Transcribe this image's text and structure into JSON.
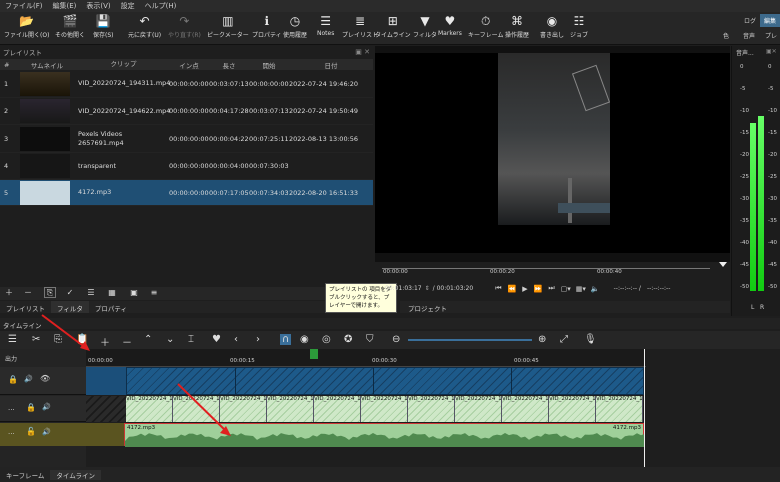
{
  "menu": [
    "ファイル(F)",
    "編集(E)",
    "表示(V)",
    "設定",
    "ヘルプ(H)"
  ],
  "toolbar": [
    {
      "icon": "folder-icon",
      "label": "ファイル開く(O)"
    },
    {
      "icon": "clapper-icon",
      "label": "その他開く"
    },
    {
      "icon": "save-icon",
      "label": "保存(S)"
    },
    {
      "icon": "undo-icon",
      "label": "元に戻す(U)"
    },
    {
      "icon": "redo-icon",
      "label": "やり直す(R)"
    },
    {
      "icon": "peak-meter-icon",
      "label": "ピークメーター"
    },
    {
      "icon": "info-icon",
      "label": "プロパティ"
    },
    {
      "icon": "history-icon",
      "label": "使用履歴"
    },
    {
      "icon": "notes-icon",
      "label": "Notes"
    },
    {
      "icon": "playlist-icon",
      "label": "プレイリスト"
    },
    {
      "icon": "timeline-icon",
      "label": "タイムライン"
    },
    {
      "icon": "filter-icon",
      "label": "フィルタ"
    },
    {
      "icon": "markers-icon",
      "label": "Markers"
    },
    {
      "icon": "keyframe-icon",
      "label": "キーフレーム"
    },
    {
      "icon": "history2-icon",
      "label": "操作履歴"
    },
    {
      "icon": "export-icon",
      "label": "書き出し"
    },
    {
      "icon": "jobs-icon",
      "label": "ジョブ"
    }
  ],
  "workspace": {
    "log": "ログ",
    "edit": "編集",
    "color": "色",
    "audio": "音声",
    "player": "プレ"
  },
  "playlist": {
    "title": "プレイリスト",
    "headers": [
      "#",
      "サムネイル",
      "クリップ",
      "イン点",
      "長さ",
      "開始",
      "日付"
    ],
    "rows": [
      {
        "num": "1",
        "clip": "VID_20220724_194311.mp4",
        "in": "00:00:00:00",
        "len": "00:03:07:13",
        "start": "00:00:00:00",
        "date": "2022-07-24 19:46:20"
      },
      {
        "num": "2",
        "clip": "VID_20220724_194622.mp4",
        "in": "00:00:00:00",
        "len": "00:04:17:28",
        "start": "00:03:07:13",
        "date": "2022-07-24 19:50:49"
      },
      {
        "num": "3",
        "clip": "Pexels Videos 2657691.mp4",
        "in": "00:00:00:00",
        "len": "00:00:04:22",
        "start": "00:07:25:11",
        "date": "2022-08-13 13:00:56"
      },
      {
        "num": "4",
        "clip": "transparent",
        "in": "00:00:00:00",
        "len": "00:00:04:00",
        "start": "00:07:30:03",
        "date": ""
      },
      {
        "num": "5",
        "clip": "4172.mp3",
        "in": "00:00:00:00",
        "len": "00:07:17:05",
        "start": "00:07:34:03",
        "date": "2022-08-20 16:51:33"
      }
    ],
    "tabs": [
      "プレイリスト",
      "フィルタ",
      "プロパティ"
    ]
  },
  "tooltip": "プレイリストの 項目をダブルクリックすると、プレイヤーで開けます。",
  "player": {
    "ruler": [
      "00:00:00",
      "00:00:20",
      "00:00:40"
    ],
    "current": "00:01:03:17",
    "total": "/ 00:01:03:20",
    "in_out": "--:--:--:-- /",
    "in_out2": "--:--:--:--",
    "project_tab": "プロジェクト"
  },
  "meter": {
    "title": "音声...",
    "scale": [
      "0",
      "-5",
      "-10",
      "-15",
      "-20",
      "-25",
      "-30",
      "-35",
      "-40",
      "-45",
      "-50"
    ],
    "channels": [
      "L",
      "R"
    ],
    "level_l": 0.74,
    "level_r": 0.77
  },
  "timeline": {
    "title": "タイムライン",
    "output_label": "出力",
    "ruler": [
      "00:00:00",
      "00:00:15",
      "00:00:30",
      "00:00:45"
    ],
    "v2_clips": [
      "VID_20220724_194",
      "VID_20220724_194",
      "VID_20220724_19431",
      "VID_20220724_194",
      "VID_20220724_194",
      "VID_20220724_194",
      "VID_20220724_19431",
      "VID_20220724_19431",
      "VID_20220724_194",
      "VID_20220724_194",
      "VID_20220724_1943"
    ],
    "audio_clip": "4172.mp3",
    "audio_clip_end": "4172.mp3",
    "track_dots": "..."
  },
  "bottom_tabs": [
    "キーフレーム",
    "タイムライン"
  ]
}
